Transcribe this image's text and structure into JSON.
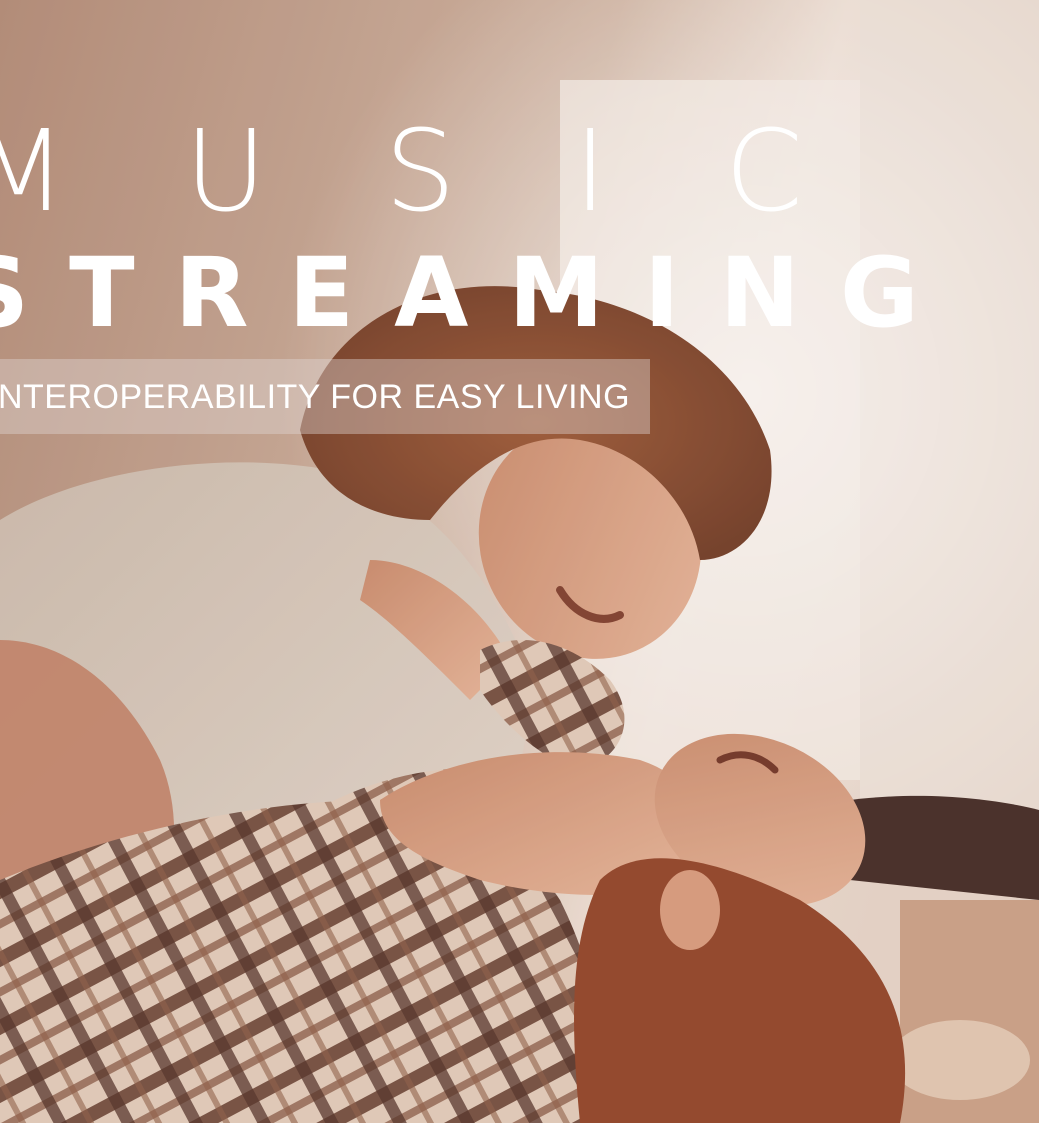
{
  "headline": {
    "line1": "MUSIC",
    "line2": "STREAMING"
  },
  "tagline": "INTEROPERABILITY FOR EASY LIVING",
  "photo": {
    "colors": {
      "background": "#b89580",
      "wall": "#d8c4b6",
      "window_light": "#f3ece6",
      "hair": "#8a4a2a",
      "skin": "#d59a7e",
      "shirt": "#d8cdc2",
      "plaid_dark": "#4a2a22",
      "plaid_light": "#e5d3c4"
    }
  }
}
